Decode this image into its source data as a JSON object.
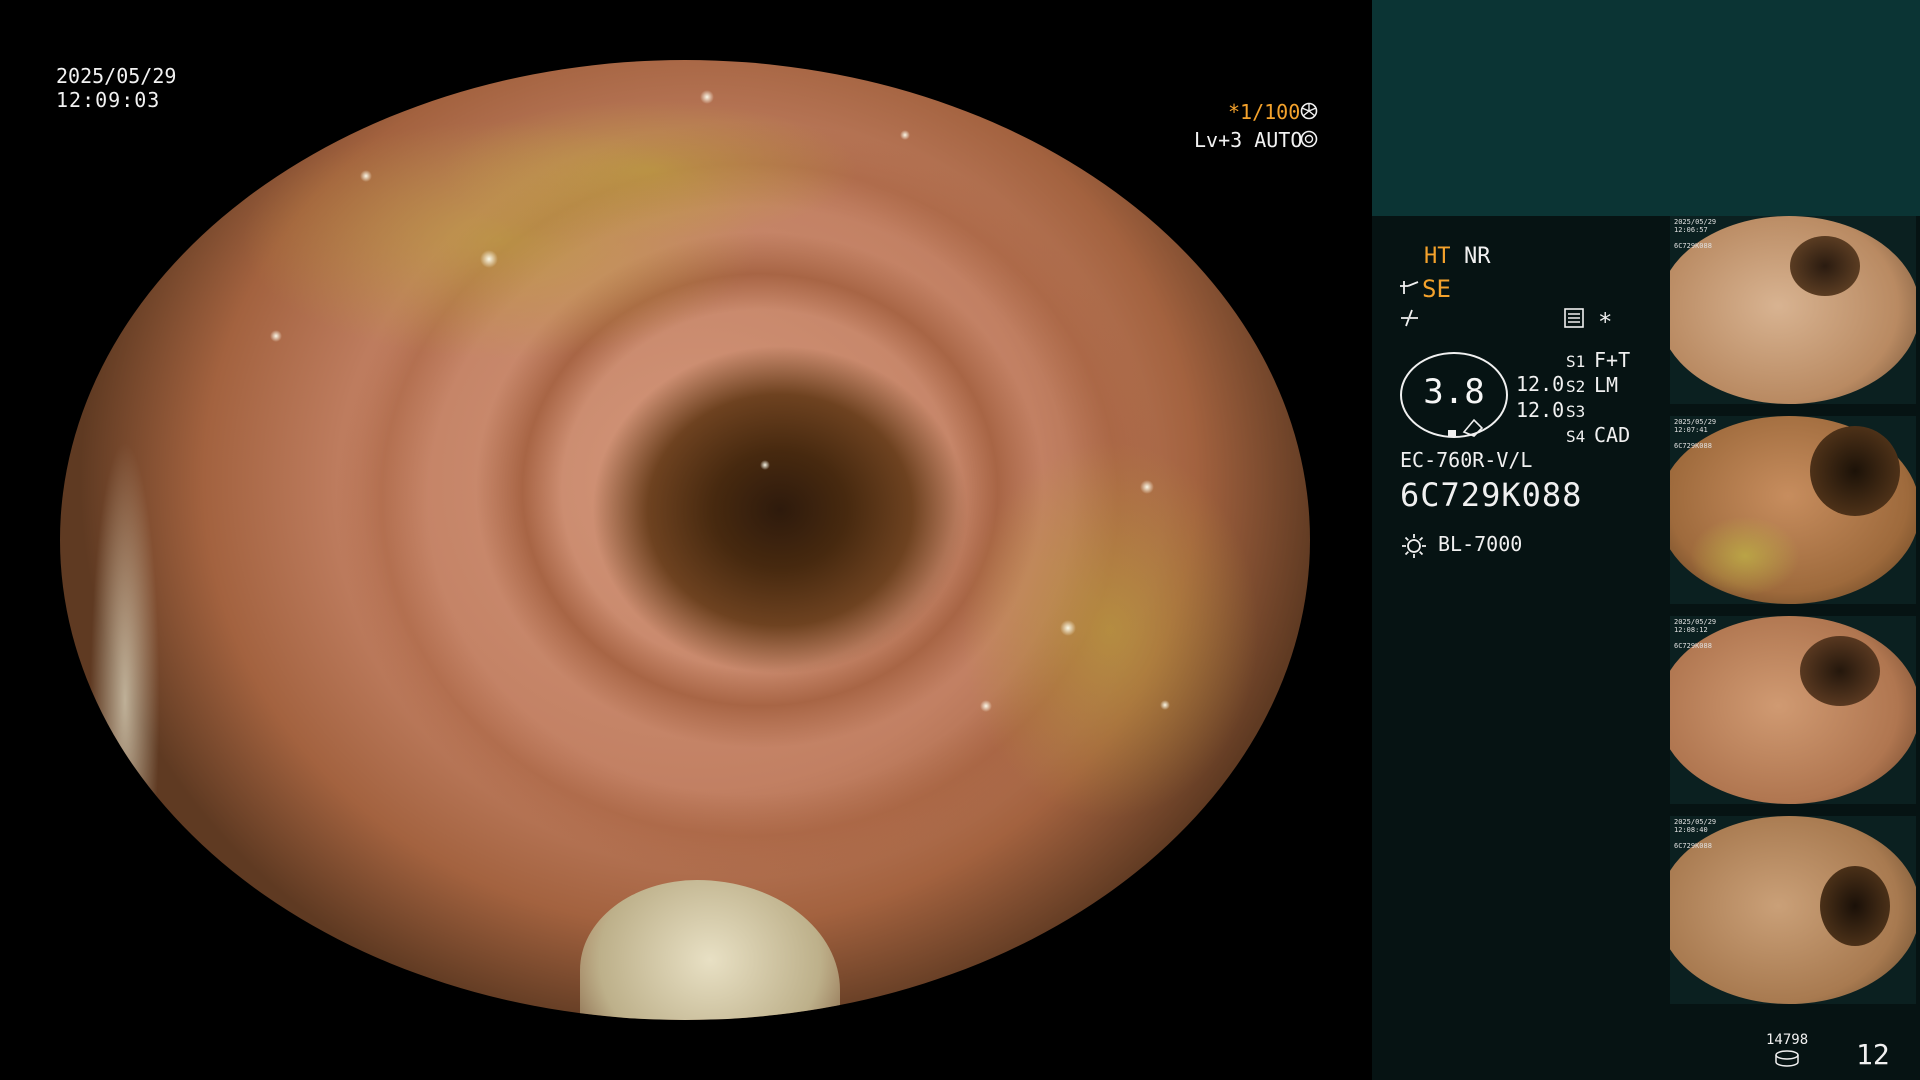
{
  "timestamp": {
    "date": "2025/05/29",
    "time": "12:09:03"
  },
  "overlay": {
    "shutter": "*1/100",
    "shutter_icon": "aperture-icon",
    "level": "Lv+3 AUTO",
    "level_icon": "iris-icon"
  },
  "panel": {
    "ht": "HT",
    "nr": "NR",
    "se": "SE",
    "se_icon": "pump-icon",
    "waveform_icon": "waveform-icon",
    "menu_icon": "menu-icon",
    "asterisk": "*",
    "zoom_value": "3.8",
    "zoom_levels": [
      "12.0",
      "12.0"
    ],
    "switches": [
      {
        "key": "S1",
        "value": "F+T"
      },
      {
        "key": "S2",
        "value": "LM"
      },
      {
        "key": "S3",
        "value": ""
      },
      {
        "key": "S4",
        "value": "CAD"
      }
    ],
    "scope_model": "EC-760R-V/L",
    "serial": "6C729K088",
    "light_icon": "sun-icon",
    "light_source": "BL-7000"
  },
  "thumbnails": [
    {
      "caption": "2025/05/29\n12:06:57\n\n6C729K088"
    },
    {
      "caption": "2025/05/29\n12:07:41\n\n6C729K088"
    },
    {
      "caption": "2025/05/29\n12:08:12\n\n6C729K088"
    },
    {
      "caption": "2025/05/29\n12:08:40\n\n6C729K088"
    }
  ],
  "footer": {
    "storage_count": "14798",
    "storage_icon": "disk-icon",
    "image_count": "12"
  },
  "colors": {
    "accent_orange": "#f4a22c",
    "panel_bg": "#061313",
    "panel_header": "#0b3434"
  }
}
